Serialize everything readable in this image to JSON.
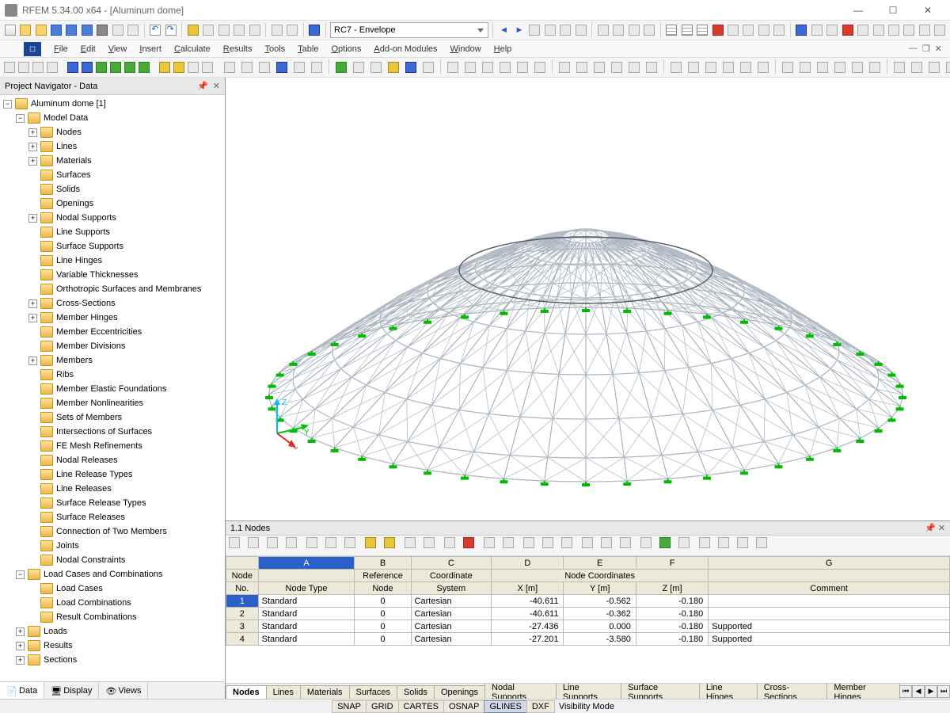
{
  "titlebar": {
    "text": "RFEM 5.34.00 x64 - [Aluminum dome]"
  },
  "windowButtons": {
    "min": "—",
    "max": "☐",
    "close": "✕"
  },
  "menubar": [
    "File",
    "Edit",
    "View",
    "Insert",
    "Calculate",
    "Results",
    "Tools",
    "Table",
    "Options",
    "Add-on Modules",
    "Window",
    "Help"
  ],
  "toolbar1": {
    "combo": "RC7 - Envelope"
  },
  "navigator": {
    "title": "Project Navigator - Data",
    "root": "Aluminum dome [1]",
    "modelData": "Model Data",
    "items": [
      "Nodes",
      "Lines",
      "Materials",
      "Surfaces",
      "Solids",
      "Openings",
      "Nodal Supports",
      "Line Supports",
      "Surface Supports",
      "Line Hinges",
      "Variable Thicknesses",
      "Orthotropic Surfaces and Membranes",
      "Cross-Sections",
      "Member Hinges",
      "Member Eccentricities",
      "Member Divisions",
      "Members",
      "Ribs",
      "Member Elastic Foundations",
      "Member Nonlinearities",
      "Sets of Members",
      "Intersections of Surfaces",
      "FE Mesh Refinements",
      "Nodal Releases",
      "Line Release Types",
      "Line Releases",
      "Surface Release Types",
      "Surface Releases",
      "Connection of Two Members",
      "Joints",
      "Nodal Constraints"
    ],
    "loadCasesGroup": "Load Cases and Combinations",
    "loadCasesItems": [
      "Load Cases",
      "Load Combinations",
      "Result Combinations"
    ],
    "bottomGroups": [
      "Loads",
      "Results",
      "Sections"
    ],
    "tabs": [
      {
        "label": "Data",
        "icon": "📄"
      },
      {
        "label": "Display",
        "icon": "🖥"
      },
      {
        "label": "Views",
        "icon": "👁"
      }
    ]
  },
  "axisLabels": {
    "x": "X",
    "y": "Y",
    "z": "Z"
  },
  "tablePanel": {
    "title": "1.1 Nodes",
    "colLetters": [
      "A",
      "B",
      "C",
      "D",
      "E",
      "F",
      "G"
    ],
    "header1": {
      "nodeNo": "Node",
      "nodeType": "",
      "refNode": "Reference",
      "coordSys": "Coordinate",
      "coords": "Node Coordinates",
      "comment": ""
    },
    "header2": {
      "nodeNo": "No.",
      "nodeType": "Node Type",
      "refNode": "Node",
      "coordSys": "System",
      "x": "X [m]",
      "y": "Y [m]",
      "z": "Z [m]",
      "comment": "Comment"
    },
    "rows": [
      {
        "n": "1",
        "type": "Standard",
        "ref": "0",
        "sys": "Cartesian",
        "x": "-40.611",
        "y": "-0.562",
        "z": "-0.180",
        "c": ""
      },
      {
        "n": "2",
        "type": "Standard",
        "ref": "0",
        "sys": "Cartesian",
        "x": "-40.611",
        "y": "-0.362",
        "z": "-0.180",
        "c": ""
      },
      {
        "n": "3",
        "type": "Standard",
        "ref": "0",
        "sys": "Cartesian",
        "x": "-27.436",
        "y": "0.000",
        "z": "-0.180",
        "c": "Supported"
      },
      {
        "n": "4",
        "type": "Standard",
        "ref": "0",
        "sys": "Cartesian",
        "x": "-27.201",
        "y": "-3.580",
        "z": "-0.180",
        "c": "Supported"
      }
    ],
    "tabs": [
      "Nodes",
      "Lines",
      "Materials",
      "Surfaces",
      "Solids",
      "Openings",
      "Nodal Supports",
      "Line Supports",
      "Surface Supports",
      "Line Hinges",
      "Cross-Sections",
      "Member Hinges"
    ]
  },
  "statusbar": {
    "segments": [
      "SNAP",
      "GRID",
      "CARTES",
      "OSNAP",
      "GLINES",
      "DXF"
    ],
    "visMode": "Visibility Mode"
  }
}
